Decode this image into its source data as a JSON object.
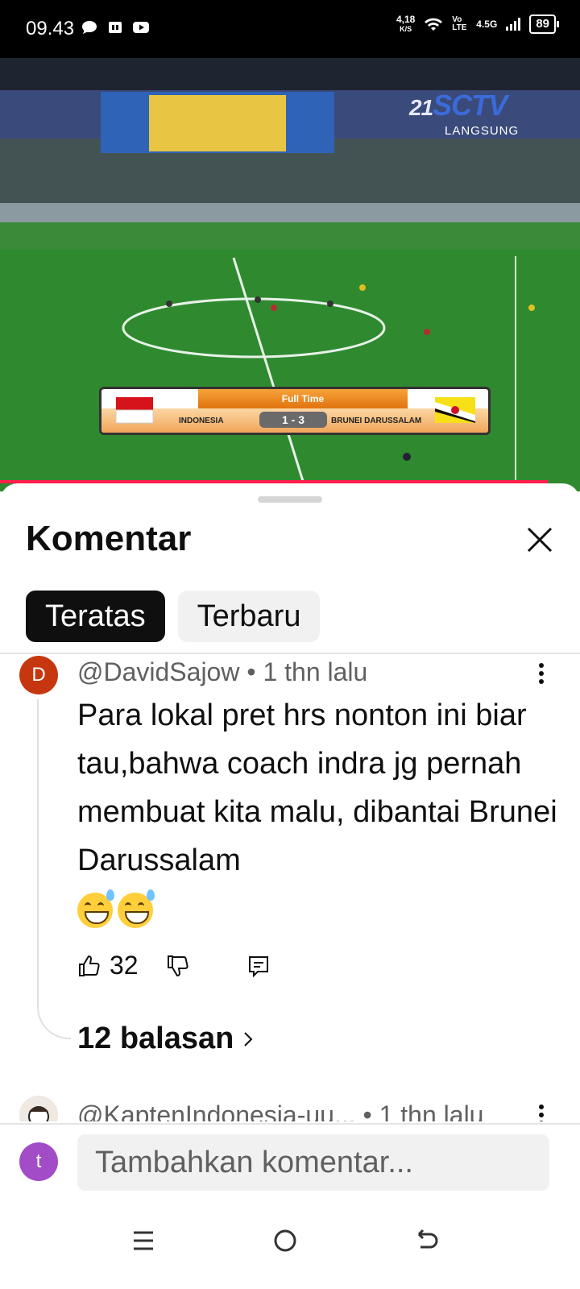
{
  "status_bar": {
    "time": "09.43",
    "net_speed_value": "4,18",
    "net_speed_unit": "K/S",
    "volte": "Vo LTE",
    "network": "4.5G",
    "battery": "89"
  },
  "video": {
    "channel": "SCTV",
    "channel_number": "21",
    "live_label": "LANGSUNG",
    "score_title": "Full Time",
    "team_home": "INDONESIA",
    "score": "1 - 3",
    "team_away": "BRUNEI DARUSSALAM",
    "progress_fraction": 0.944
  },
  "sheet": {
    "title": "Komentar",
    "tabs": [
      {
        "label": "Teratas",
        "active": true
      },
      {
        "label": "Terbaru",
        "active": false
      }
    ]
  },
  "comments": [
    {
      "avatar_letter": "D",
      "avatar_color": "#c6370f",
      "author": "@DavidSajow",
      "time": "1 thn lalu",
      "text": "Para lokal pret hrs nonton ini biar tau,bahwa coach indra jg pernah membuat kita malu, dibantai Brunei Darussalam",
      "emoji": [
        "grinning-sweat",
        "grinning-sweat"
      ],
      "likes": "32",
      "replies": "12 balasan"
    },
    {
      "author": "@KaptenIndonesia-uu...",
      "time": "1 thn lalu"
    }
  ],
  "composer": {
    "avatar_letter": "t",
    "avatar_color": "#a24cc7",
    "placeholder": "Tambahkan komentar..."
  },
  "icons": {
    "close": "close-icon",
    "more": "more-vert-icon",
    "like": "thumb-up-icon",
    "dislike": "thumb-down-icon",
    "reply": "reply-icon",
    "chevron": "chevron-right-icon"
  }
}
